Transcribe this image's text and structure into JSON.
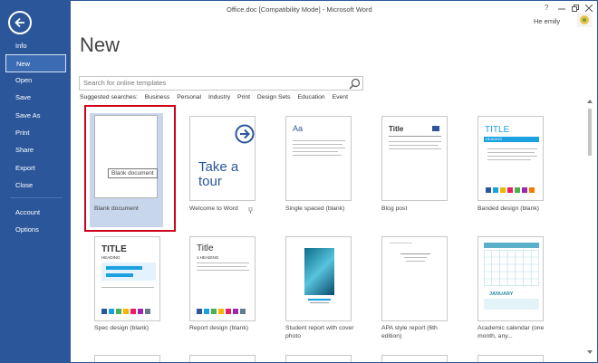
{
  "app": {
    "window_title": "Office.doc [Compatibility Mode] - Microsoft Word",
    "help": "?",
    "user": "He emily"
  },
  "sidebar": {
    "items": [
      {
        "label": "Info"
      },
      {
        "label": "New"
      },
      {
        "label": "Open"
      },
      {
        "label": "Save"
      },
      {
        "label": "Save As"
      },
      {
        "label": "Print"
      },
      {
        "label": "Share"
      },
      {
        "label": "Export"
      },
      {
        "label": "Close"
      },
      {
        "label": "Account"
      },
      {
        "label": "Options"
      }
    ]
  },
  "main": {
    "title": "New",
    "search_placeholder": "Search for online templates",
    "suggested_label": "Suggested searches:",
    "suggested": [
      "Business",
      "Personal",
      "Industry",
      "Print",
      "Design Sets",
      "Education",
      "Event"
    ],
    "tooltip": "Blank document",
    "templates": [
      {
        "caption": "Blank document"
      },
      {
        "caption": "Welcome to Word",
        "thumb_text": "Take a tour"
      },
      {
        "caption": "Single spaced (blank)",
        "thumb_text": "Aa"
      },
      {
        "caption": "Blog post",
        "thumb_text": "Title"
      },
      {
        "caption": "Banded design (blank)",
        "thumb_text": "TITLE",
        "thumb_sub": "HEADING"
      },
      {
        "caption": "Spec design (blank)",
        "thumb_text": "TITLE",
        "thumb_sub": "HEADING"
      },
      {
        "caption": "Report design (blank)",
        "thumb_text": "Title",
        "thumb_sub": "1 HEADING"
      },
      {
        "caption": "Student report with cover photo"
      },
      {
        "caption": "APA style report (6th edition)"
      },
      {
        "caption": "Academic calendar (one month, any...",
        "thumb_text": "JANUARY"
      }
    ]
  },
  "colors": {
    "accent": "#2b579a",
    "highlight": "#d0021b",
    "teal": "#1ba1e2"
  }
}
